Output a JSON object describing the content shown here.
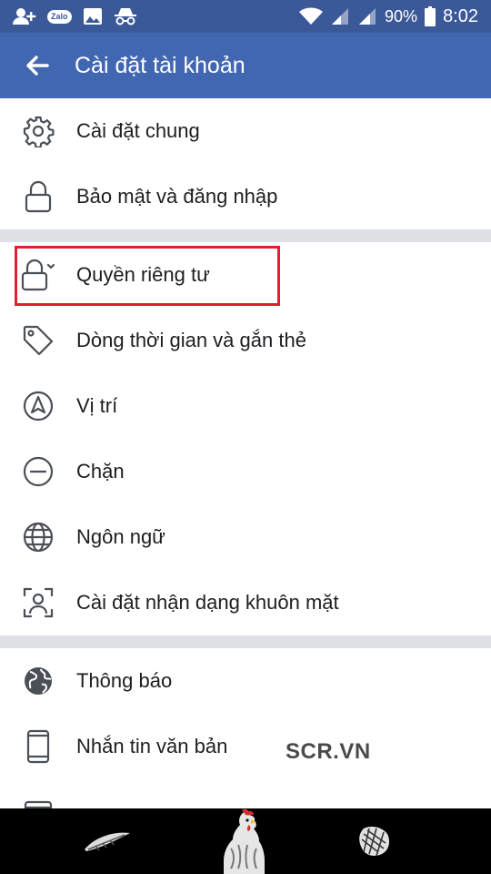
{
  "status_bar": {
    "zalo_label": "Zalo",
    "battery": "90%",
    "time": "8:02",
    "icons": [
      "add-friend-icon",
      "zalo-icon",
      "gallery-icon",
      "incognito-icon",
      "wifi-icon",
      "signal-icon",
      "signal-icon",
      "battery-icon"
    ]
  },
  "app_bar": {
    "title": "Cài đặt tài khoản",
    "background": "#4267b2"
  },
  "menu": {
    "items": [
      {
        "label": "Cài đặt chung",
        "icon": "gear-icon"
      },
      {
        "label": "Bảo mật và đăng nhập",
        "icon": "lock-icon"
      },
      {
        "label": "Quyền riêng tư",
        "icon": "lock-dropdown-icon"
      },
      {
        "label": "Dòng thời gian và gắn thẻ",
        "icon": "tag-icon"
      },
      {
        "label": "Vị trí",
        "icon": "navigation-icon"
      },
      {
        "label": "Chặn",
        "icon": "block-icon"
      },
      {
        "label": "Ngôn ngữ",
        "icon": "globe-icon"
      },
      {
        "label": "Cài đặt nhận dạng khuôn mặt",
        "icon": "face-recognition-icon"
      },
      {
        "label": "Thông báo",
        "icon": "earth-icon"
      },
      {
        "label": "Nhắn tin văn bản",
        "icon": "phone-icon"
      }
    ],
    "highlight_color": "#e0202e"
  },
  "watermark": "SCR.VN"
}
